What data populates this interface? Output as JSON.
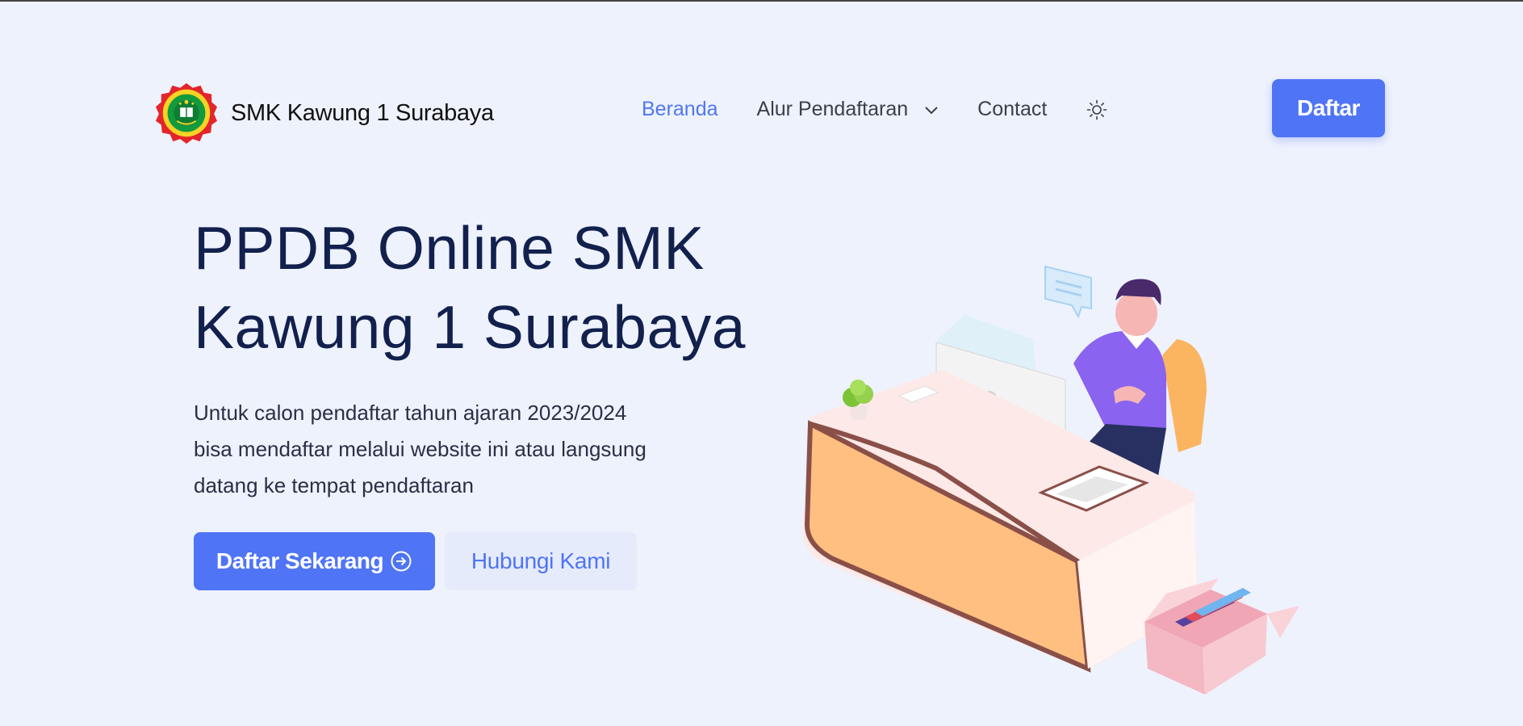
{
  "header": {
    "brand_name": "SMK Kawung 1 Surabaya",
    "nav": {
      "beranda": "Beranda",
      "alur": "Alur Pendaftaran",
      "contact": "Contact"
    },
    "daftar_label": "Daftar"
  },
  "hero": {
    "title_line1": "PPDB Online SMK",
    "title_line2": "Kawung 1 Surabaya",
    "desc_line1": "Untuk calon pendaftar tahun ajaran 2023/2024",
    "desc_line2": "bisa mendaftar melalui website ini atau langsung",
    "desc_line3": "datang ke tempat pendaftaran",
    "cta_primary": "Daftar Sekarang",
    "cta_secondary": "Hubungi Kami"
  },
  "colors": {
    "background": "#eef2fd",
    "accent": "#4f74f5",
    "active_nav": "#4f78f0",
    "heading": "#12204d"
  },
  "icons": {
    "logo": "school-emblem-logo",
    "dropdown": "chevron-down-icon",
    "theme": "sun-icon",
    "cta": "arrow-right-circle-icon"
  }
}
